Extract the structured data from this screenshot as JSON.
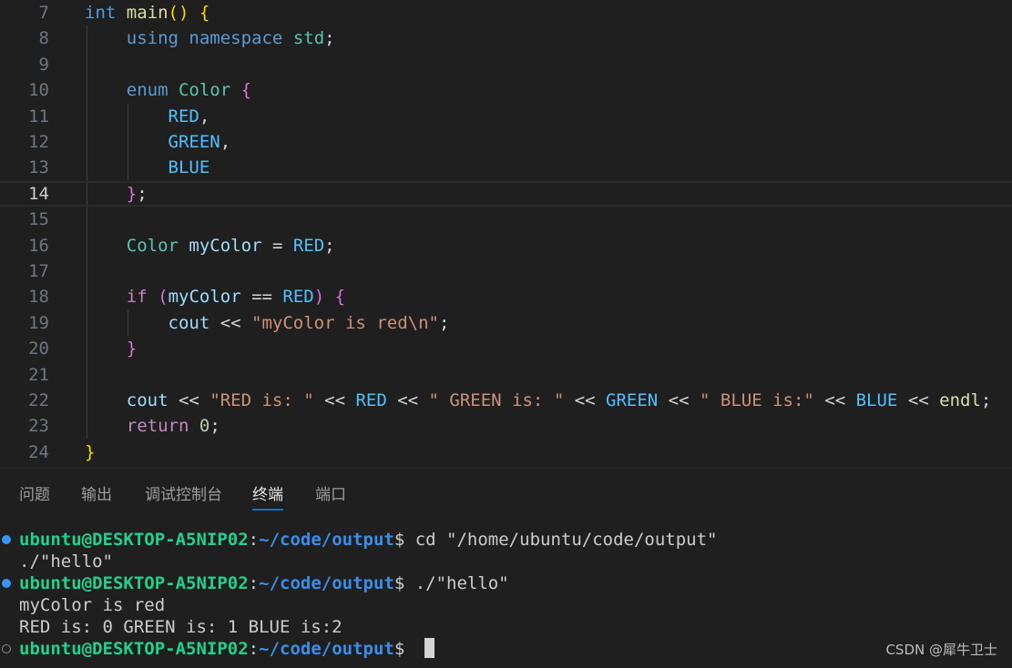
{
  "editor": {
    "lines": [
      {
        "num": "7",
        "tokens": [
          [
            "int",
            "k-type"
          ],
          [
            " ",
            ""
          ],
          [
            "main",
            "t-func"
          ],
          [
            "()",
            "b1"
          ],
          [
            " ",
            ""
          ],
          [
            "{",
            "b1"
          ]
        ]
      },
      {
        "num": "8",
        "tokens": [
          [
            "    ",
            ""
          ],
          [
            "using",
            "k-type"
          ],
          [
            " ",
            ""
          ],
          [
            "namespace",
            "k-type"
          ],
          [
            " ",
            ""
          ],
          [
            "std",
            "t-type"
          ],
          [
            ";",
            "t-op"
          ]
        ]
      },
      {
        "num": "9",
        "tokens": []
      },
      {
        "num": "10",
        "tokens": [
          [
            "    ",
            ""
          ],
          [
            "enum",
            "k-type"
          ],
          [
            " ",
            ""
          ],
          [
            "Color",
            "t-type"
          ],
          [
            " ",
            ""
          ],
          [
            "{",
            "b2"
          ]
        ]
      },
      {
        "num": "11",
        "tokens": [
          [
            "        ",
            ""
          ],
          [
            "RED",
            "t-enum"
          ],
          [
            ",",
            "t-op"
          ]
        ]
      },
      {
        "num": "12",
        "tokens": [
          [
            "        ",
            ""
          ],
          [
            "GREEN",
            "t-enum"
          ],
          [
            ",",
            "t-op"
          ]
        ]
      },
      {
        "num": "13",
        "tokens": [
          [
            "        ",
            ""
          ],
          [
            "BLUE",
            "t-enum"
          ]
        ]
      },
      {
        "num": "14",
        "tokens": [
          [
            "    ",
            ""
          ],
          [
            "}",
            "b2"
          ],
          [
            ";",
            "t-op"
          ]
        ]
      },
      {
        "num": "15",
        "tokens": []
      },
      {
        "num": "16",
        "tokens": [
          [
            "    ",
            ""
          ],
          [
            "Color",
            "t-type"
          ],
          [
            " ",
            ""
          ],
          [
            "myColor",
            "t-var"
          ],
          [
            " = ",
            "t-op"
          ],
          [
            "RED",
            "t-enum"
          ],
          [
            ";",
            "t-op"
          ]
        ]
      },
      {
        "num": "17",
        "tokens": []
      },
      {
        "num": "18",
        "tokens": [
          [
            "    ",
            ""
          ],
          [
            "if",
            "k-flow"
          ],
          [
            " ",
            ""
          ],
          [
            "(",
            "b2"
          ],
          [
            "myColor",
            "t-var"
          ],
          [
            " == ",
            "t-op"
          ],
          [
            "RED",
            "t-enum"
          ],
          [
            ")",
            "b2"
          ],
          [
            " ",
            ""
          ],
          [
            "{",
            "b2"
          ]
        ]
      },
      {
        "num": "19",
        "tokens": [
          [
            "        ",
            ""
          ],
          [
            "cout",
            "t-var"
          ],
          [
            " << ",
            "t-op"
          ],
          [
            "\"myColor is red\\n\"",
            "t-str"
          ],
          [
            ";",
            "t-op"
          ]
        ]
      },
      {
        "num": "20",
        "tokens": [
          [
            "    ",
            ""
          ],
          [
            "}",
            "b2"
          ]
        ]
      },
      {
        "num": "21",
        "tokens": []
      },
      {
        "num": "22",
        "tokens": [
          [
            "    ",
            ""
          ],
          [
            "cout",
            "t-var"
          ],
          [
            " << ",
            "t-op"
          ],
          [
            "\"RED is: \"",
            "t-str"
          ],
          [
            " << ",
            "t-op"
          ],
          [
            "RED",
            "t-enum"
          ],
          [
            " << ",
            "t-op"
          ],
          [
            "\" GREEN is: \"",
            "t-str"
          ],
          [
            " << ",
            "t-op"
          ],
          [
            "GREEN",
            "t-enum"
          ],
          [
            " << ",
            "t-op"
          ],
          [
            "\" BLUE is:\"",
            "t-str"
          ],
          [
            " << ",
            "t-op"
          ],
          [
            "BLUE",
            "t-enum"
          ],
          [
            " << ",
            "t-op"
          ],
          [
            "endl",
            "t-func"
          ],
          [
            ";",
            "t-op"
          ]
        ]
      },
      {
        "num": "23",
        "tokens": [
          [
            "    ",
            ""
          ],
          [
            "return",
            "k-flow"
          ],
          [
            " ",
            ""
          ],
          [
            "0",
            "t-num"
          ],
          [
            ";",
            "t-op"
          ]
        ]
      },
      {
        "num": "24",
        "tokens": [
          [
            "}",
            "b1"
          ]
        ]
      }
    ],
    "active_line": "14"
  },
  "panel": {
    "tabs": [
      {
        "label": "问题",
        "active": false
      },
      {
        "label": "输出",
        "active": false
      },
      {
        "label": "调试控制台",
        "active": false
      },
      {
        "label": "终端",
        "active": true
      },
      {
        "label": "端口",
        "active": false
      }
    ]
  },
  "terminal": {
    "user_host": "ubuntu@DESKTOP-A5NIP02",
    "path": "~/code/output",
    "lines": [
      {
        "dot": "blue",
        "prompt": true,
        "cmd": " cd \"/home/ubuntu/code/output\""
      },
      {
        "dot": "",
        "prompt": false,
        "text": "./\"hello\""
      },
      {
        "dot": "blue",
        "prompt": true,
        "cmd": " ./\"hello\""
      },
      {
        "dot": "",
        "prompt": false,
        "text": "myColor is red"
      },
      {
        "dot": "",
        "prompt": false,
        "text": "RED is: 0 GREEN is: 1 BLUE is:2"
      },
      {
        "dot": "hollow",
        "prompt": true,
        "cmd": " ",
        "cursor": true
      }
    ]
  },
  "watermark": "CSDN @犀牛卫士",
  "colors": {
    "background": "#1f1f1f",
    "accent": "#0078d4",
    "prompt_host": "#23d18b",
    "prompt_path": "#3b8eea"
  }
}
